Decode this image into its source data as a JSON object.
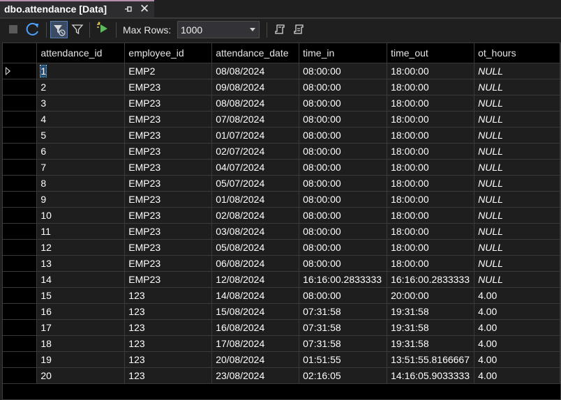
{
  "tab": {
    "title": "dbo.attendance [Data]"
  },
  "toolbar": {
    "max_rows_label": "Max Rows:",
    "max_rows_value": "1000"
  },
  "colors": {
    "tab_accent": "#b48ead",
    "selection": "#264f78"
  },
  "table": {
    "columns": [
      "attendance_id",
      "employee_id",
      "attendance_date",
      "time_in",
      "time_out",
      "ot_hours"
    ],
    "rows": [
      [
        "1",
        "EMP2",
        "08/08/2024",
        "08:00:00",
        "18:00:00",
        "NULL"
      ],
      [
        "2",
        "EMP23",
        "09/08/2024",
        "08:00:00",
        "18:00:00",
        "NULL"
      ],
      [
        "3",
        "EMP23",
        "08/08/2024",
        "08:00:00",
        "18:00:00",
        "NULL"
      ],
      [
        "4",
        "EMP23",
        "07/08/2024",
        "08:00:00",
        "18:00:00",
        "NULL"
      ],
      [
        "5",
        "EMP23",
        "01/07/2024",
        "08:00:00",
        "18:00:00",
        "NULL"
      ],
      [
        "6",
        "EMP23",
        "02/07/2024",
        "08:00:00",
        "18:00:00",
        "NULL"
      ],
      [
        "7",
        "EMP23",
        "04/07/2024",
        "08:00:00",
        "18:00:00",
        "NULL"
      ],
      [
        "8",
        "EMP23",
        "05/07/2024",
        "08:00:00",
        "18:00:00",
        "NULL"
      ],
      [
        "9",
        "EMP23",
        "01/08/2024",
        "08:00:00",
        "18:00:00",
        "NULL"
      ],
      [
        "10",
        "EMP23",
        "02/08/2024",
        "08:00:00",
        "18:00:00",
        "NULL"
      ],
      [
        "11",
        "EMP23",
        "03/08/2024",
        "08:00:00",
        "18:00:00",
        "NULL"
      ],
      [
        "12",
        "EMP23",
        "05/08/2024",
        "08:00:00",
        "18:00:00",
        "NULL"
      ],
      [
        "13",
        "EMP23",
        "06/08/2024",
        "08:00:00",
        "18:00:00",
        "NULL"
      ],
      [
        "14",
        "EMP23",
        "12/08/2024",
        "16:16:00.2833333",
        "16:16:00.2833333",
        "NULL"
      ],
      [
        "15",
        "123",
        "14/08/2024",
        "08:00:00",
        "20:00:00",
        "4.00"
      ],
      [
        "16",
        "123",
        "15/08/2024",
        "07:31:58",
        "19:31:58",
        "4.00"
      ],
      [
        "17",
        "123",
        "16/08/2024",
        "07:31:58",
        "19:31:58",
        "4.00"
      ],
      [
        "18",
        "123",
        "17/08/2024",
        "07:31:58",
        "19:31:58",
        "4.00"
      ],
      [
        "19",
        "123",
        "20/08/2024",
        "01:51:55",
        "13:51:55.8166667",
        "4.00"
      ],
      [
        "20",
        "123",
        "23/08/2024",
        "02:16:05",
        "14:16:05.9033333",
        "4.00"
      ]
    ]
  }
}
